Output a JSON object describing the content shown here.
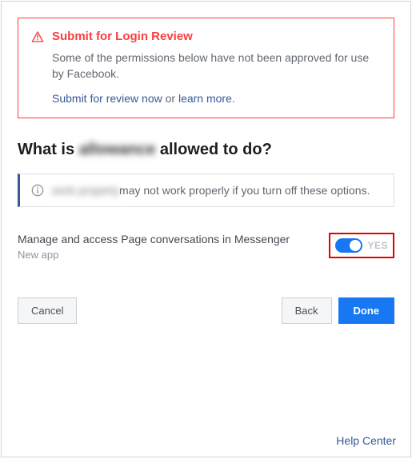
{
  "alert": {
    "title": "Submit for Login Review",
    "body": "Some of the permissions below have not been approved for use by Facebook.",
    "submit_link": "Submit for review now",
    "or_text": " or ",
    "learn_link": "learn more",
    "period": "."
  },
  "heading": {
    "prefix": "What is ",
    "blurred": "allowance",
    "suffix": "allowed to do?"
  },
  "info_bar": {
    "blurred": "work properly",
    "text": "may not work properly if you turn off these options."
  },
  "permission": {
    "title": "Manage and access Page conversations in Messenger",
    "subtitle": "New app",
    "toggle_label": "YES"
  },
  "buttons": {
    "cancel": "Cancel",
    "back": "Back",
    "done": "Done"
  },
  "footer": {
    "help": "Help Center"
  }
}
